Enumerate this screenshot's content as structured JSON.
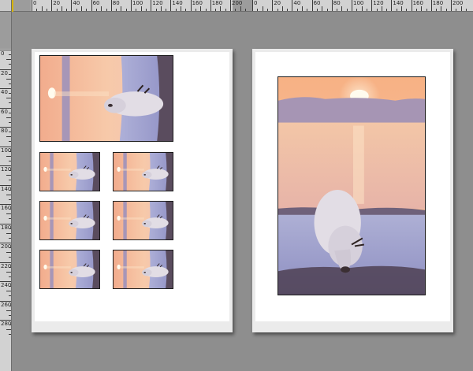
{
  "ruler_top": {
    "labels_left": [
      "0",
      "20",
      "40",
      "60",
      "80",
      "100",
      "120",
      "140",
      "160",
      "180",
      "200"
    ],
    "labels_right": [
      "0",
      "20",
      "40",
      "60",
      "80",
      "100",
      "120",
      "140",
      "160",
      "180",
      "200"
    ]
  },
  "ruler_left": {
    "labels": [
      "0",
      "20",
      "40",
      "60",
      "80",
      "100",
      "120",
      "140",
      "160",
      "180",
      "200",
      "220",
      "240",
      "260",
      "280"
    ]
  },
  "left_page": {
    "main_photo": {
      "subject": "reindeer-sunset-rotated"
    },
    "thumbnail_count": 6
  },
  "right_page": {
    "main_photo": {
      "subject": "reindeer-sunset"
    }
  },
  "colors": {
    "canvas": "#8e8e8e",
    "paper": "#ffffff",
    "ruler": "#d2d2d2",
    "guide": "#d6b400"
  }
}
